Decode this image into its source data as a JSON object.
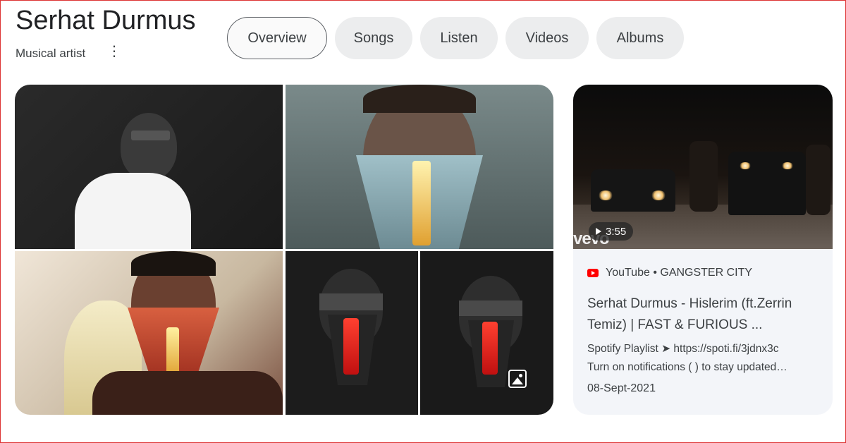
{
  "artist": {
    "name": "Serhat Durmus",
    "type": "Musical artist"
  },
  "tabs": [
    {
      "label": "Overview",
      "active": true
    },
    {
      "label": "Songs",
      "active": false
    },
    {
      "label": "Listen",
      "active": false
    },
    {
      "label": "Videos",
      "active": false
    },
    {
      "label": "Albums",
      "active": false
    }
  ],
  "video": {
    "duration": "3:55",
    "watermark": "vevo",
    "source": "YouTube • GANGSTER CITY",
    "title": "Serhat Durmus - Hislerim (ft.Zerrin Temiz) | FAST & FURIOUS ...",
    "description_line1": "Spotify Playlist ➤ https://spoti.fi/3jdnx3c",
    "description_line2": "Turn on notifications ( ) to stay updated…",
    "date": "08-Sept-2021"
  },
  "icons": {
    "more": "more-vert-icon",
    "image": "image-icon",
    "youtube": "youtube-icon",
    "play": "play-icon"
  },
  "colors": {
    "tab_bg": "#ecedee",
    "card_bg": "#f3f5f9",
    "youtube_red": "#ff0000"
  }
}
